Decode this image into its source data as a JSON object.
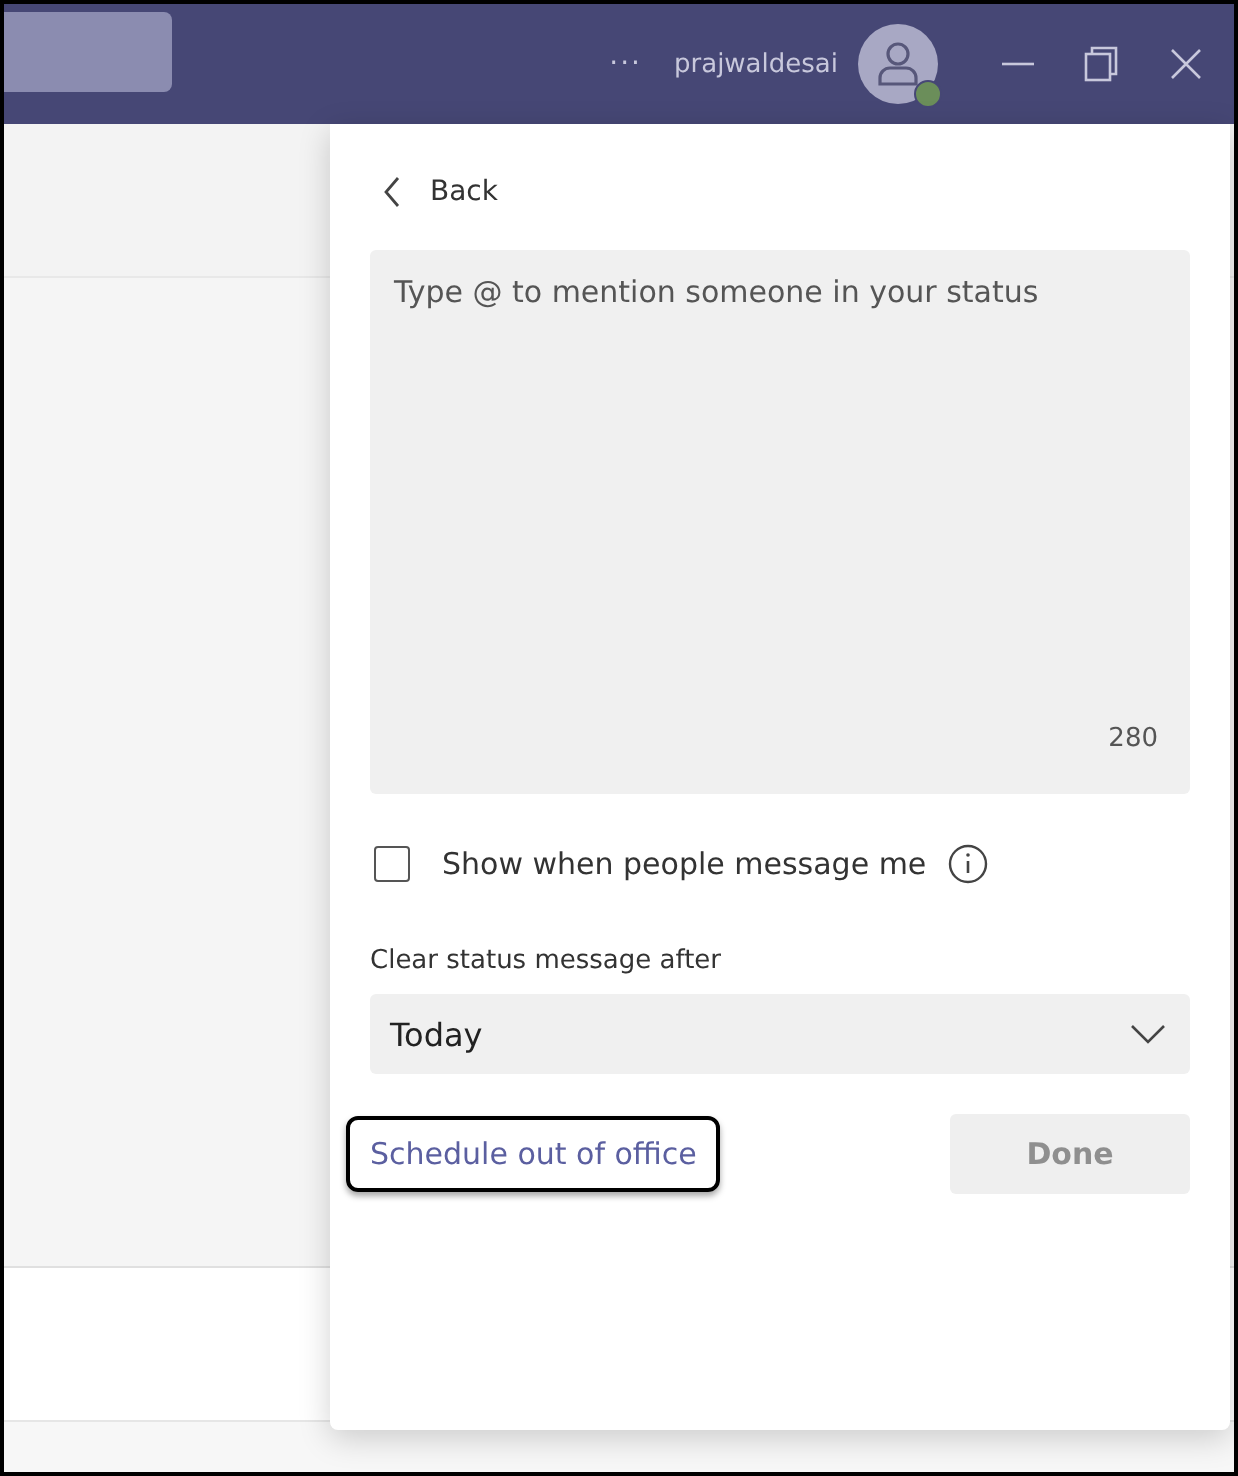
{
  "title_bar": {
    "more": "···",
    "username": "prajwaldesai"
  },
  "status_panel": {
    "back": "Back",
    "message": {
      "placeholder": "Type @ to mention someone in your status",
      "counter": "280"
    },
    "show_when_messaged": {
      "label": "Show when people message me",
      "checked": false
    },
    "clear_after": {
      "label": "Clear status message after",
      "value": "Today"
    },
    "schedule_link": {
      "label": "Schedule out of office",
      "highlighted": true
    },
    "done_button": {
      "label": "Done",
      "disabled": true
    }
  }
}
